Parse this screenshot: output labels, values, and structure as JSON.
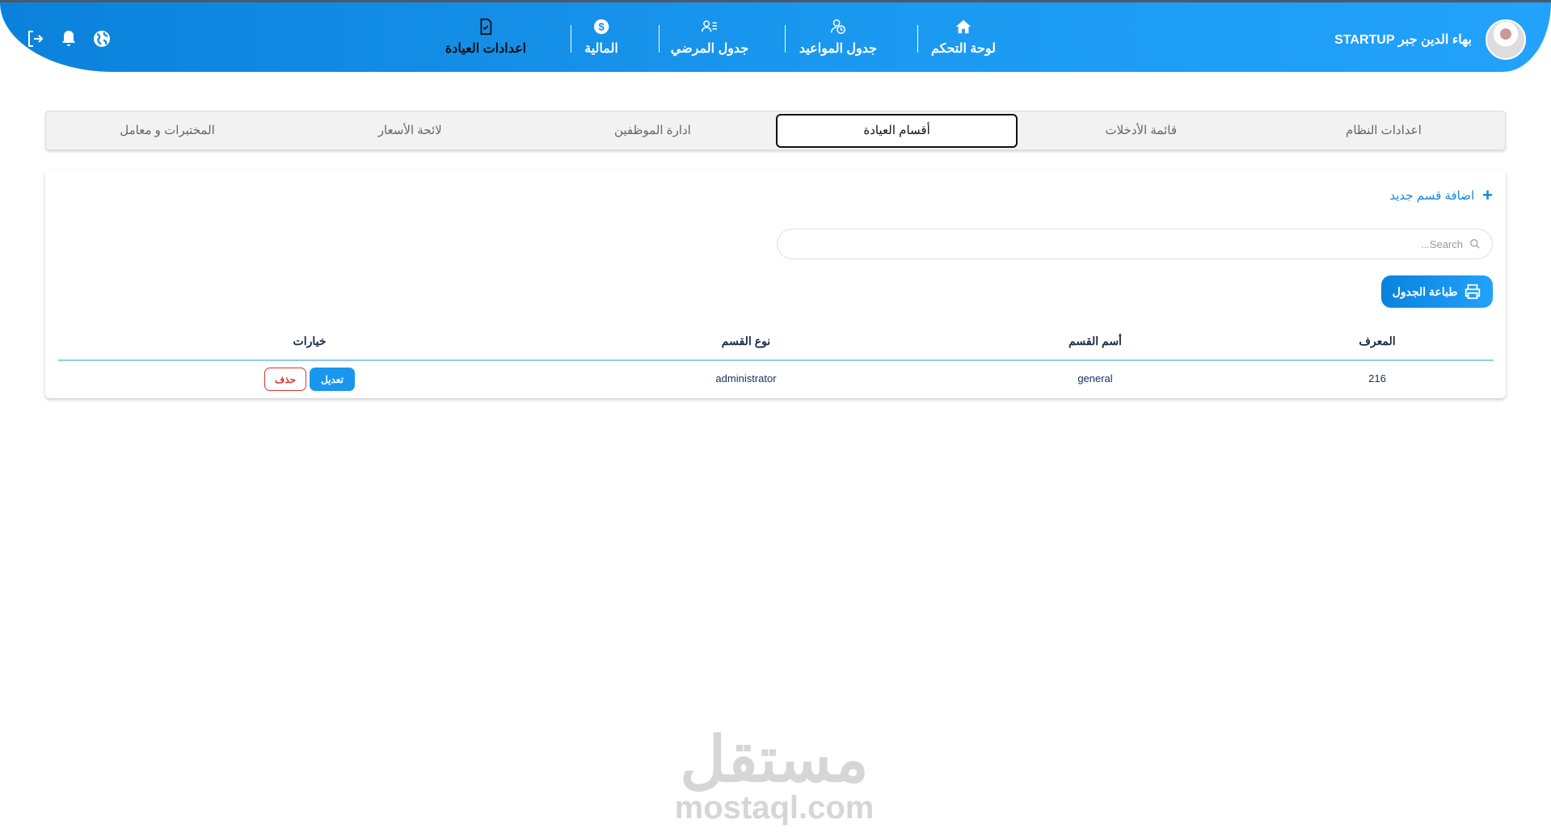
{
  "header": {
    "user_name": "بهاء الدين جبر STARTUP",
    "nav": [
      {
        "label": "لوحة التحكم",
        "icon": "home-icon"
      },
      {
        "label": "جدول المواعيد",
        "icon": "user-clock-icon"
      },
      {
        "label": "جدول المرضي",
        "icon": "user-list-icon"
      },
      {
        "label": "المالية",
        "icon": "dollar-icon"
      },
      {
        "label": "اعدادات العيادة",
        "icon": "file-check-icon"
      }
    ]
  },
  "tabs": [
    "اعدادات النظام",
    "قائمة الأدخلات",
    "أقسام العيادة",
    "ادارة الموظفين",
    "لائحة الأسعار",
    "المختبرات و معامل"
  ],
  "card": {
    "add_label": "اضافة قسم جديد",
    "search_placeholder": "Search...",
    "print_label": "طباعة الجدول",
    "columns": [
      "المعرف",
      "أسم القسم",
      "نوع القسم",
      "خيارات"
    ],
    "rows": [
      {
        "id": "216",
        "name": "general",
        "type": "administrator",
        "edit": "تعديل",
        "delete": "حذف"
      }
    ]
  },
  "watermark": {
    "ar": "مستقل",
    "en": "mostaql.com"
  }
}
